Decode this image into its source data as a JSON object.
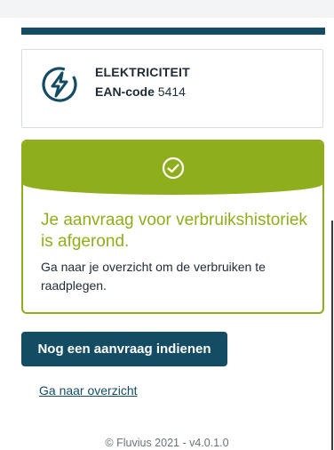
{
  "meter": {
    "type_label": "ELEKTRICITEIT",
    "ean_label": "EAN-code",
    "ean_value": "5414",
    "icon": "lightning-bolt-icon"
  },
  "confirmation": {
    "icon": "check-circle-icon",
    "title": "Je aanvraag voor verbruikshistoriek is afgerond.",
    "message": "Ga naar je overzicht om de verbruiken te raadplegen."
  },
  "actions": {
    "new_request_label": "Nog een aanvraag indienen",
    "overview_link_label": "Ga naar overzicht"
  },
  "footer": {
    "copyright": "© Fluvius 2021 - v4.0.1.0"
  },
  "colors": {
    "primary": "#144c63",
    "success": "#8fae1b"
  }
}
